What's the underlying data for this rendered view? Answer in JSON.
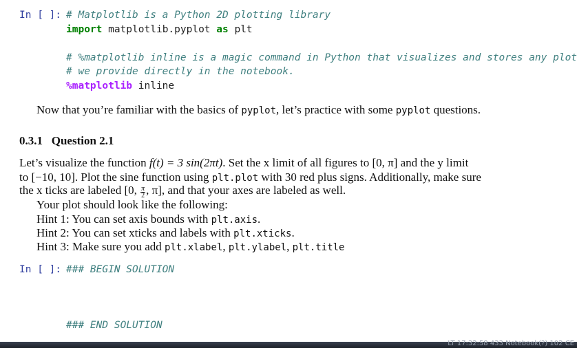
{
  "cell1": {
    "prompt": "In [ ]:",
    "line1_comment": "# Matplotlib is a Python 2D plotting library",
    "line2_kw_import": "import",
    "line2_module": " matplotlib.pyplot ",
    "line2_kw_as": "as",
    "line2_alias": " plt",
    "line3_comment": "# %matplotlib inline is a magic command in Python that visualizes and stores any plots",
    "line4_comment": "# we provide directly in the notebook.",
    "line5_magic": "%matplotlib",
    "line5_arg": " inline"
  },
  "intro": {
    "text_a": "Now that you’re familiar with the basics of ",
    "code_a": "pyplot",
    "text_b": ", let’s practice with some ",
    "code_b": "pyplot",
    "text_c": " questions."
  },
  "heading": {
    "number": "0.3.1",
    "title": "Question 2.1"
  },
  "question": {
    "l1_a": "Let’s visualize the function ",
    "l1_math": "f(t) = 3 sin(2πt)",
    "l1_b": ". Set the x limit of all figures to ",
    "l1_xlim": "[0, π]",
    "l1_c": " and the y limit",
    "l2_a": "to ",
    "l2_ylim": "[−10, 10]",
    "l2_b": ". Plot the sine function using ",
    "l2_code": "plt.plot",
    "l2_c": " with 30 red plus signs. Additionally, make sure",
    "l3_a": "the x ticks are labeled ",
    "l3_open": "[0, ",
    "l3_num": "π",
    "l3_den": "2",
    "l3_close": ", π]",
    "l3_b": ", and that your axes are labeled as well.",
    "l4": "Your plot should look like the following:",
    "hint1_a": "Hint 1: You can set axis bounds with ",
    "hint1_code": "plt.axis",
    "hint1_b": ".",
    "hint2_a": "Hint 2: You can set xticks and labels with ",
    "hint2_code": "plt.xticks",
    "hint2_b": ".",
    "hint3_a": "Hint 3: Make sure you add ",
    "hint3_code1": "plt.xlabel",
    "hint3_sep1": ", ",
    "hint3_code2": "plt.ylabel",
    "hint3_sep2": ", ",
    "hint3_code3": "plt.title"
  },
  "cell2": {
    "prompt": "In [ ]:",
    "begin": "### BEGIN SOLUTION",
    "end": "### END SOLUTION"
  },
  "taskbar": {
    "text": "LT 17:32:58  433  Notebook(?)   102 CE"
  }
}
